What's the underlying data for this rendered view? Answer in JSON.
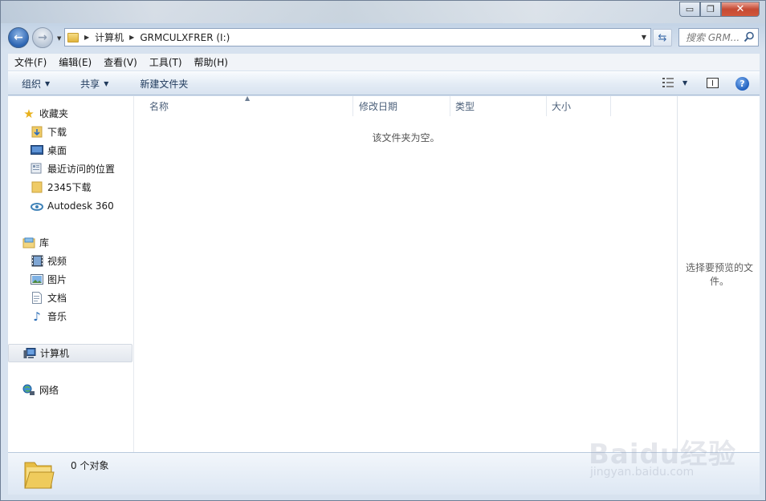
{
  "window": {
    "caption_buttons": {
      "minimize": "▭",
      "maximize": "❐",
      "close": "✕"
    }
  },
  "address": {
    "crumbs": [
      "计算机",
      "GRMCULXFRER (I:)"
    ]
  },
  "search": {
    "placeholder": "搜索 GRM..."
  },
  "menu": [
    "文件(F)",
    "编辑(E)",
    "查看(V)",
    "工具(T)",
    "帮助(H)"
  ],
  "toolbar": {
    "organize": "组织",
    "share": "共享",
    "new_folder": "新建文件夹"
  },
  "nav": {
    "favorites": {
      "label": "收藏夹",
      "items": [
        "下载",
        "桌面",
        "最近访问的位置",
        "2345下载",
        "Autodesk 360"
      ]
    },
    "libraries": {
      "label": "库",
      "items": [
        "视频",
        "图片",
        "文档",
        "音乐"
      ]
    },
    "computer": "计算机",
    "network": "网络"
  },
  "columns": [
    "名称",
    "修改日期",
    "类型",
    "大小"
  ],
  "content": {
    "empty_message": "该文件夹为空。"
  },
  "preview": {
    "message": "选择要预览的文件。"
  },
  "details": {
    "count_text": "0 个对象"
  },
  "watermark": {
    "brand": "Baidu经验",
    "url": "jingyan.baidu.com"
  },
  "colors": {
    "accent": "#1e395b",
    "selection": "#e2e7ee",
    "close": "#c54a33"
  }
}
